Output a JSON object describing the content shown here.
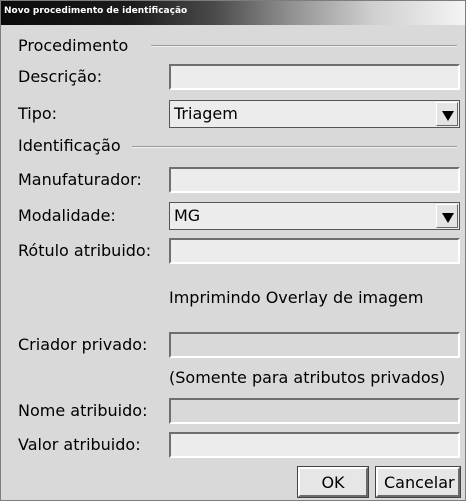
{
  "window": {
    "title": "Novo procedimento de identificação"
  },
  "procedure": {
    "heading": "Procedimento",
    "description_label": "Descrição:",
    "description_value": "",
    "type_label": "Tipo:",
    "type_value": "Triagem"
  },
  "identification": {
    "heading": "Identificação",
    "manufacturer_label": "Manufaturador:",
    "manufacturer_value": "",
    "modality_label": "Modalidade:",
    "modality_value": "MG",
    "assigned_label_label": "Rótulo atribuido:",
    "assigned_label_value": "",
    "overlay_text": "Imprimindo Overlay de imagem",
    "private_creator_label": "Criador privado:",
    "private_creator_value": "",
    "private_note": "(Somente para atributos privados)",
    "assigned_name_label": "Nome atribuido:",
    "assigned_name_value": "",
    "assigned_value_label": "Valor atribuido:",
    "assigned_value_value": ""
  },
  "buttons": {
    "ok": "OK",
    "cancel": "Cancelar"
  },
  "icons": {
    "dropdown": "chevron-down-icon"
  }
}
